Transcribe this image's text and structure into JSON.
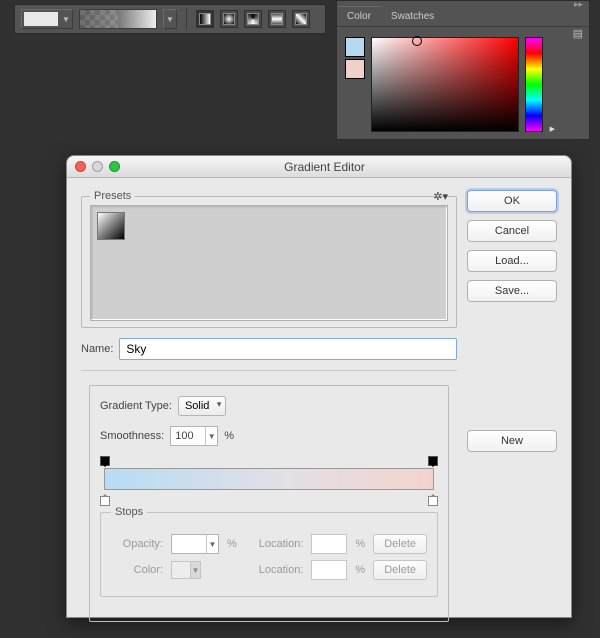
{
  "toolbar": {
    "fill_swatch": "#e8e8e8",
    "modes": [
      "Linear",
      "Radial",
      "Angle",
      "Reflected",
      "Diamond"
    ]
  },
  "color_panel": {
    "tabs": {
      "color": "Color",
      "swatches": "Swatches"
    },
    "fg": "#b7d9ef",
    "bg": "#f0d1c9",
    "hue_selected": "#ff0000"
  },
  "dialog": {
    "title": "Gradient Editor",
    "presets": {
      "legend": "Presets"
    },
    "buttons": {
      "ok": "OK",
      "cancel": "Cancel",
      "load": "Load...",
      "save": "Save...",
      "new": "New"
    },
    "name_label": "Name:",
    "name_value": "Sky",
    "gradient_type_label": "Gradient Type:",
    "gradient_type_value": "Solid",
    "smoothness_label": "Smoothness:",
    "smoothness_value": "100",
    "percent": "%",
    "gradient_stops": {
      "start_color": "#b7dcf4",
      "end_color": "#f4d3cd"
    },
    "stops": {
      "legend": "Stops",
      "opacity_label": "Opacity:",
      "location_label": "Location:",
      "color_label": "Color:",
      "delete": "Delete"
    }
  }
}
